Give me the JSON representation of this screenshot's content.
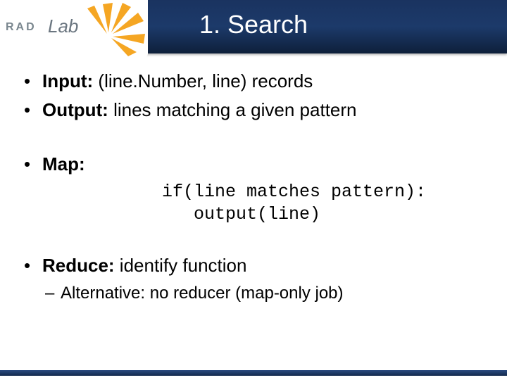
{
  "header": {
    "title": "1. Search",
    "logo": {
      "rad": "RAD",
      "lab": "Lab"
    }
  },
  "body": {
    "b1_label": "Input:",
    "b1_text": " (line.Number, line) records",
    "b2_label": "Output:",
    "b2_text": " lines matching a given pattern",
    "b3_label": "Map:",
    "code_l1": "if(line matches pattern):",
    "code_l2": "   output(line)",
    "b4_label": "Reduce:",
    "b4_text": " identify function",
    "sub1": "Alternative: no reducer (map-only job)"
  }
}
